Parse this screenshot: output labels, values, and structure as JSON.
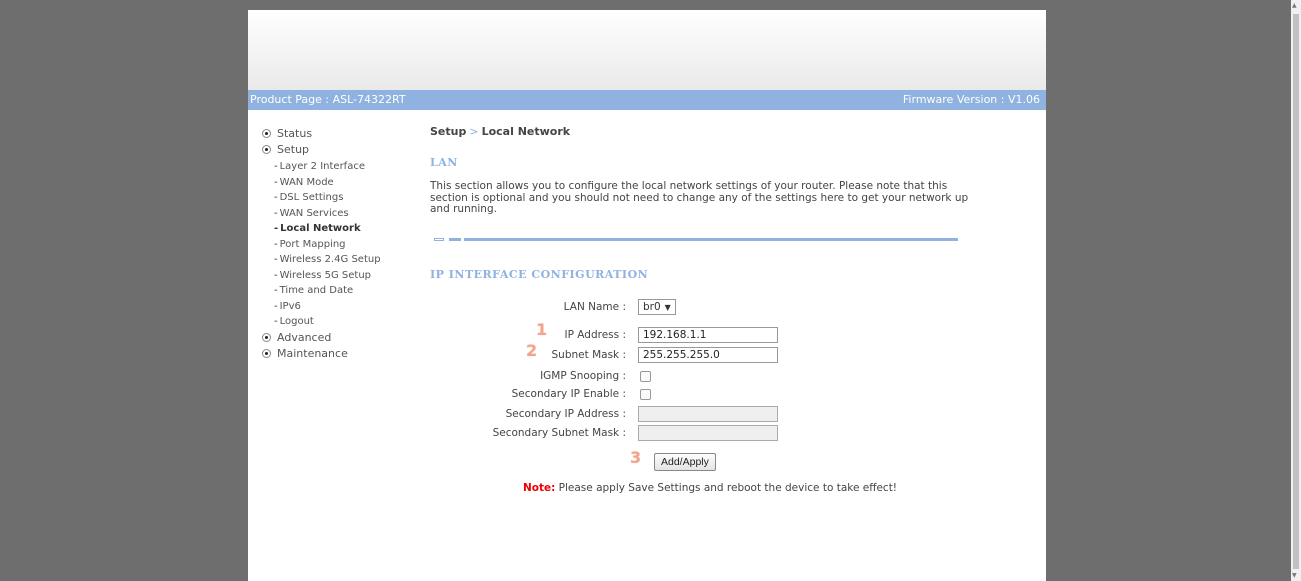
{
  "header": {
    "product_label": "Product Page : ",
    "product_name": "ASL-74322RT",
    "firmware_label": "Firmware Version : ",
    "firmware_version": "V1.06"
  },
  "sidebar": {
    "sections": [
      {
        "label": "Status"
      },
      {
        "label": "Setup"
      },
      {
        "label": "Advanced"
      },
      {
        "label": "Maintenance"
      }
    ],
    "setup_items": [
      {
        "label": "Layer 2 Interface"
      },
      {
        "label": "WAN Mode"
      },
      {
        "label": "DSL Settings"
      },
      {
        "label": "WAN Services"
      },
      {
        "label": "Local Network"
      },
      {
        "label": "Port Mapping"
      },
      {
        "label": "Wireless 2.4G Setup"
      },
      {
        "label": "Wireless 5G Setup"
      },
      {
        "label": "Time and Date"
      },
      {
        "label": "IPv6"
      },
      {
        "label": "Logout"
      }
    ],
    "active_item": "Local Network"
  },
  "breadcrumb": {
    "parent": "Setup",
    "separator": ">",
    "current": "Local Network"
  },
  "lan": {
    "section_title": "LAN",
    "description": "This section allows you to configure the local network settings of your router. Please note that this section is optional and you should not need to change any of the settings here to get your network up and running.",
    "ip_config_title": "IP INTERFACE CONFIGURATION"
  },
  "form": {
    "lan_name_label": "LAN Name :",
    "lan_name_value": "br0",
    "ip_address_label": "IP Address :",
    "ip_address_value": "192.168.1.1",
    "subnet_mask_label": "Subnet Mask :",
    "subnet_mask_value": "255.255.255.0",
    "igmp_label": "IGMP Snooping :",
    "igmp_checked": false,
    "secondary_ip_enable_label": "Secondary IP Enable :",
    "secondary_ip_enable_checked": false,
    "secondary_ip_address_label": "Secondary IP Address :",
    "secondary_ip_address_value": "",
    "secondary_subnet_label": "Secondary Subnet Mask :",
    "secondary_subnet_value": "",
    "apply_button": "Add/Apply",
    "step_markers": [
      "1",
      "2",
      "3"
    ]
  },
  "note": {
    "label": "Note:",
    "text": " Please apply Save Settings and reboot the device to take effect!"
  },
  "colors": {
    "accent": "#8fb2e0",
    "note_red": "#e00000",
    "step_marker": "#f0a58c",
    "outer_background": "#6e6e6e"
  }
}
